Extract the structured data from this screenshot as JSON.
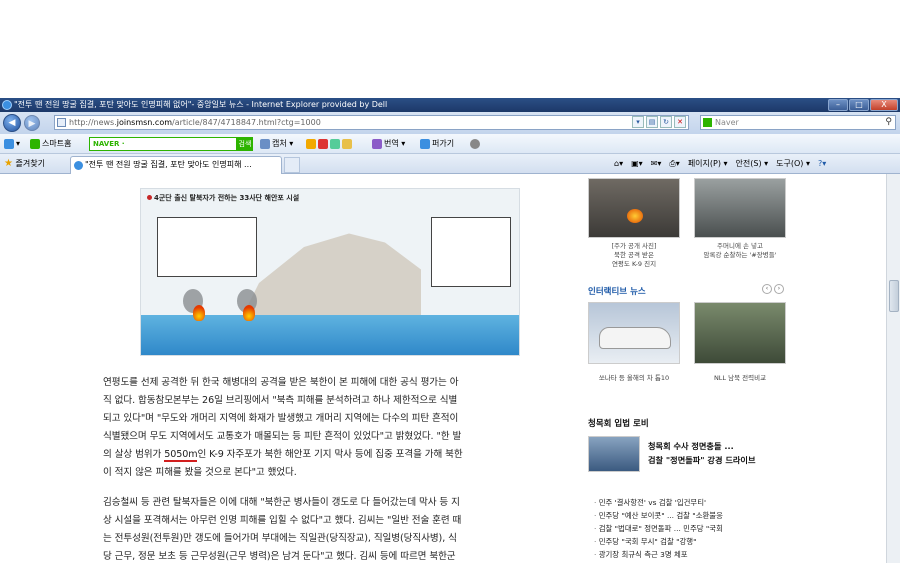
{
  "window": {
    "title": "\"전투 땐 전원 땅굴 집결, 포탄 맞아도 인명피해 없어\"- 중앙일보 뉴스 - Internet Explorer provided by Dell",
    "min": "–",
    "max": "□",
    "close": "X"
  },
  "address": {
    "url_prefix": "http://news.",
    "url_domain": "joinsmsn.com",
    "url_path": "/article/847/4718847.html?ctg=1000",
    "search_placeholder": "Naver"
  },
  "toolbar": {
    "smart_home": "스마트홈",
    "naver_input": "NAVER ·",
    "search_go": "검색",
    "capture": "캡처 ▾",
    "translate": "번역",
    "paste": "퍼가기"
  },
  "tabs": {
    "favorites": "즐겨찾기",
    "active_tab": "\"전투 땐 전원 땅굴 집결, 포탄 맞아도 인명피해 ...",
    "page_menu": "페이지(P) ▾",
    "safety_menu": "안전(S) ▾",
    "tools_menu": "도구(O) ▾",
    "help": "?▾"
  },
  "figure": {
    "title": "4군단 출신 탈북자가 전하는 33사단 해안포 시설"
  },
  "article": {
    "p1_line1": "연평도를 선제 공격한 뒤 한국 해병대의 공격을 받은 북한이 본 피해에 대한 공식 평가는 아",
    "p1_line2": "직 없다. 합동참모본부는 26일 브리핑에서 \"북측 피해를 분석하려고 하나 제한적으로 식별",
    "p1_line3": "되고 있다\"며 \"무도와 개머리 지역에 화재가 발생했고 개머리 지역에는 다수의 피탄 흔적이",
    "p1_line4": "식별됐으며 무도 지역에서도 교통호가 매몰되는 등 피탄 흔적이 있었다\"고 밝혔었다. \"한 발",
    "p1_line5_a": "의 살상 범위가 ",
    "p1_line5_hl": "5050m",
    "p1_line5_b": "인 K-9 자주포가 북한 해안포 기지 막사 등에 집중 포격을 가해 북한",
    "p1_line6": "이 적지 않은 피해를 봤을 것으로 본다\"고 했었다.",
    "p2_line1": "김승철씨 등 관련 탈북자들은 이에 대해 \"북한군 병사들이 갱도로 다 들어갔는데 막사 등 지",
    "p2_line2": "상 시설을 포격해서는 아무런 인명 피해를 입힐 수 없다\"고 했다. 김씨는 \"일반 전술 훈련 때",
    "p2_line3": "는 전투성원(전투원)만 갱도에 들어가며 부대에는 직일관(당직장교), 직일병(당직사병), 식",
    "p2_line4": "당 근무, 정문 보초 등 근무성원(근무 병력)은 남겨 둔다\"고 했다. 김씨 등에 따르면 북한군"
  },
  "sidebar": {
    "photo1_caption_l1": "[주가 공개 사진]",
    "photo1_caption_l2": "북한 공격 받은",
    "photo1_caption_l3": "연평도 K-9 진지",
    "photo2_caption_l1": "주머니에 손 넣고",
    "photo2_caption_l2": "암록강 순찰하는 '#장병들'",
    "interactive_title_a": "인터랙티브 ",
    "interactive_title_b": "뉴스",
    "pager_prev": "‹",
    "pager_next": "›",
    "photo3_caption": "쏘나타 등 올해의 차 톱10",
    "photo4_caption": "NLL 남북 전력비교",
    "lobby_title": "청목회 입법 로비",
    "headline_l1": "청목회 수사 정면충돌 ...",
    "headline_l2": "검찰 \"정면돌파\" 강경 드라이브",
    "list": [
      "민주 '결사항전' vs 검찰 '입건무티'",
      "민주당 \"예산 보이콧\" ... 검찰 \"소환불응",
      "검찰 \"법대로\" 정면돌파 ... 민주당 \"국회",
      "민주당 \"국회 무시\" 검찰 \"강행\"",
      "광기장 최규식 측근 3명 체포"
    ]
  }
}
